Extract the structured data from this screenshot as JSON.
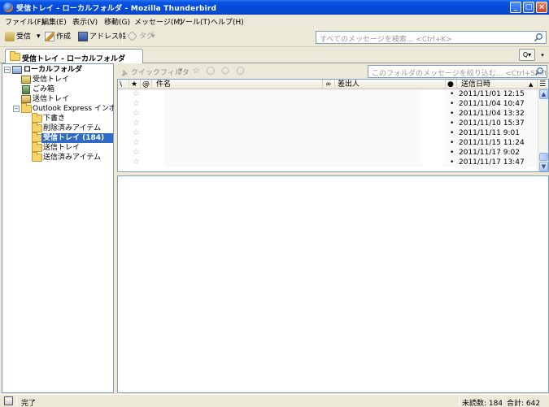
{
  "window": {
    "title": "受信トレイ - ローカルフォルダ - Mozilla Thunderbird",
    "minimize_glyph": "_",
    "maximize_glyph": "□",
    "close_glyph": "×"
  },
  "menu": {
    "items": [
      "ファイル(F)",
      "編集(E)",
      "表示(V)",
      "移動(G)",
      "メッセージ(M)",
      "ツール(T)",
      "ヘルプ(H)"
    ]
  },
  "toolbar": {
    "get_label": "受信",
    "write_label": "作成",
    "address_label": "アドレス帳",
    "tag_label": "タグ",
    "dropdown_glyph": "▾",
    "global_search_placeholder": "すべてのメッセージを検索... <Ctrl+K>"
  },
  "tabs": {
    "active_label": "受信トレイ - ローカルフォルダ",
    "menu_glyph": "Q▾",
    "overflow_glyph": "▾"
  },
  "folders": {
    "root_label": "ローカルフォルダ",
    "inbox_label": "受信トレイ",
    "trash_label": "ごみ箱",
    "sent_label": "送信トレイ",
    "oe_label": "Outlook Express インポート",
    "oe_items": [
      "下書き",
      "削除済みアイテム",
      "受信トレイ (184)",
      "送信トレイ",
      "送信済みアイテム"
    ],
    "expanded_glyph": "−"
  },
  "quickfilter": {
    "label": "クイックフィルタ",
    "search_placeholder": "このフォルダのメッセージを絞り込む... <Ctrl+Shift+K>"
  },
  "thread": {
    "columns": {
      "thread_glyph": "\\",
      "star_glyph": "★",
      "attach_glyph": "@",
      "subject": "件名",
      "junk_glyph": "∞",
      "sender": "差出人",
      "read_glyph": "●",
      "date": "送信日時",
      "sort_glyph": "▲",
      "picker_glyph": "☰"
    },
    "star_empty": "☆",
    "bullet": "•",
    "rows": [
      {
        "date": "2011/11/01 12:15"
      },
      {
        "date": "2011/11/04 10:47"
      },
      {
        "date": "2011/11/04 13:32"
      },
      {
        "date": "2011/11/10 15:37"
      },
      {
        "date": "2011/11/11 9:01"
      },
      {
        "date": "2011/11/15 11:24"
      },
      {
        "date": "2011/11/17 9:02"
      },
      {
        "date": "2011/11/17 13:47"
      }
    ],
    "scroll_up_glyph": "▲",
    "scroll_down_glyph": "▼"
  },
  "status": {
    "text": "完了",
    "unread": "未読数: 184",
    "total": "合計: 642"
  }
}
